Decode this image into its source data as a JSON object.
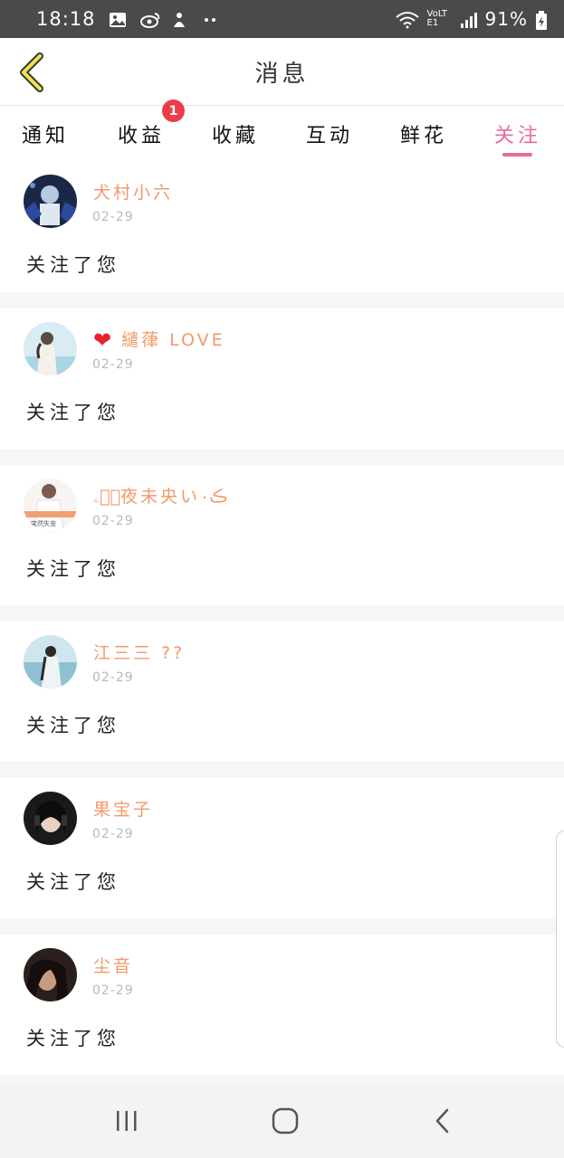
{
  "status_bar": {
    "time": "18:18",
    "battery_text": "91%",
    "network_text": "VoLTE1",
    "icons": [
      "image-icon",
      "weibo-icon",
      "app-icon",
      "dots-icon",
      "wifi-icon",
      "signal-icon",
      "battery-icon"
    ]
  },
  "header": {
    "title": "消息",
    "back_icon": "chevron-left-icon"
  },
  "tabs": [
    {
      "label": "通知"
    },
    {
      "label": "收益",
      "badge": "1"
    },
    {
      "label": "收藏"
    },
    {
      "label": "互动"
    },
    {
      "label": "鲜花"
    },
    {
      "label": "关注",
      "active": true
    }
  ],
  "messages": [
    {
      "name": "犬村小六",
      "date": "02-29",
      "text": "关注了您"
    },
    {
      "name": "繾葎 LOVE",
      "prefix_icon": "heart-icon",
      "date": "02-29",
      "text": "关注了您"
    },
    {
      "name": "ۦ﹏ۣ夜未央いڪ۰",
      "date": "02-29",
      "text": "关注了您",
      "avatar_caption": "突然失宠"
    },
    {
      "name": "江三三 ??",
      "date": "02-29",
      "text": "关注了您"
    },
    {
      "name": "果宝子",
      "date": "02-29",
      "text": "关注了您"
    },
    {
      "name": "尘音",
      "date": "02-29",
      "text": "关注了您"
    }
  ],
  "nav_bar": {
    "buttons": [
      "recent-apps-icon",
      "home-icon",
      "back-icon"
    ]
  },
  "colors": {
    "accent": "#e86b9e",
    "name": "#f09a6a",
    "badge": "#ec3b4a",
    "status_bar": "#4a4a4a"
  }
}
